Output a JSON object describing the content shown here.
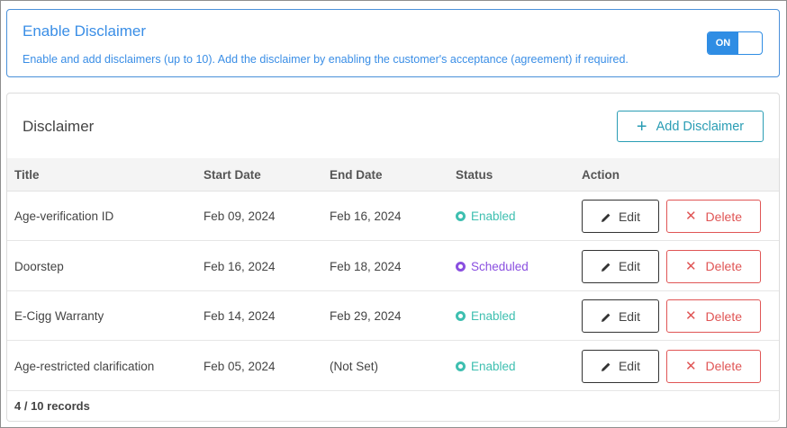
{
  "banner": {
    "title": "Enable Disclaimer",
    "description": "Enable and add disclaimers (up to 10). Add the disclaimer by enabling the customer's acceptance (agreement) if required.",
    "toggle_label": "ON"
  },
  "card": {
    "title": "Disclaimer",
    "add_button_label": "Add Disclaimer",
    "columns": [
      "Title",
      "Start Date",
      "End Date",
      "Status",
      "Action"
    ],
    "edit_label": "Edit",
    "delete_label": "Delete",
    "footer": "4 / 10 records"
  },
  "colors": {
    "enabled": "#3ebfb0",
    "scheduled": "#8a4fe0",
    "accent": "#2f8de4",
    "delete": "#e05555"
  },
  "rows": [
    {
      "title": "Age-verification ID",
      "start": "Feb 09, 2024",
      "end": "Feb 16, 2024",
      "status": "Enabled",
      "status_type": "enabled"
    },
    {
      "title": "Doorstep",
      "start": "Feb 16, 2024",
      "end": "Feb 18, 2024",
      "status": "Scheduled",
      "status_type": "scheduled"
    },
    {
      "title": "E-Cigg Warranty",
      "start": "Feb 14, 2024",
      "end": "Feb 29, 2024",
      "status": "Enabled",
      "status_type": "enabled"
    },
    {
      "title": "Age-restricted clarification",
      "start": "Feb 05, 2024",
      "end": "(Not Set)",
      "status": "Enabled",
      "status_type": "enabled"
    }
  ]
}
